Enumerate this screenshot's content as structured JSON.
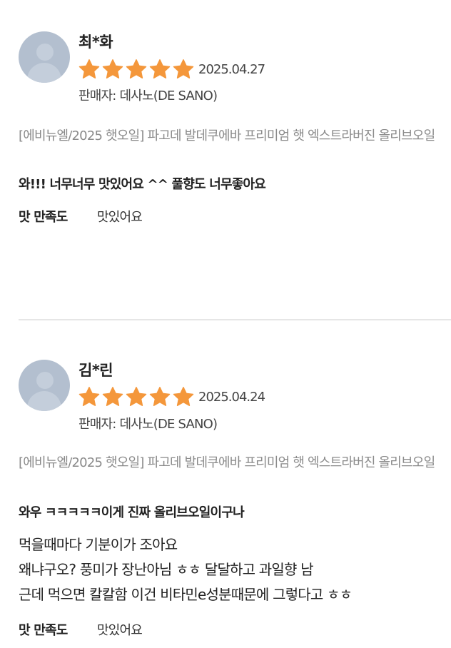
{
  "reviews": [
    {
      "reviewer": "최*화",
      "rating": 5,
      "rating_max": 5,
      "date": "2025.04.27",
      "seller": "판매자: 데사노(DE SANO)",
      "product": "[에비뉴엘/2025 햇오일] 파고데 발데쿠에바 프리미엄 햇 엑스트라버진 올리브오일",
      "headline": "와!!! 너무너무 맛있어요 ^^ 풀향도 너무좋아요",
      "body_lines": [],
      "attribute_label": "맛 만족도",
      "attribute_value": "맛있어요"
    },
    {
      "reviewer": "김*린",
      "rating": 5,
      "rating_max": 5,
      "date": "2025.04.24",
      "seller": "판매자: 데사노(DE SANO)",
      "product": "[에비뉴엘/2025 햇오일] 파고데 발데쿠에바 프리미엄 햇 엑스트라버진 올리브오일",
      "headline": "와우 ㅋㅋㅋㅋㅋ이게 진짜 올리브오일이구나",
      "body_lines": [
        "먹을때마다 기분이가 조아요",
        "왜냐구오? 풍미가 장난아님 ㅎㅎ 달달하고 과일향 남",
        "근데 먹으면 칼칼함 이건 비타민e성분때문에 그렇다고 ㅎㅎ"
      ],
      "attribute_label": "맛 만족도",
      "attribute_value": "맛있어요"
    }
  ],
  "colors": {
    "star": "#f4973b",
    "avatar": "#b3bfcf",
    "divider": "#e6e6e6",
    "product_text": "#8a8a8a"
  },
  "icons": {
    "star": "star-icon",
    "avatar": "user-avatar-icon"
  }
}
